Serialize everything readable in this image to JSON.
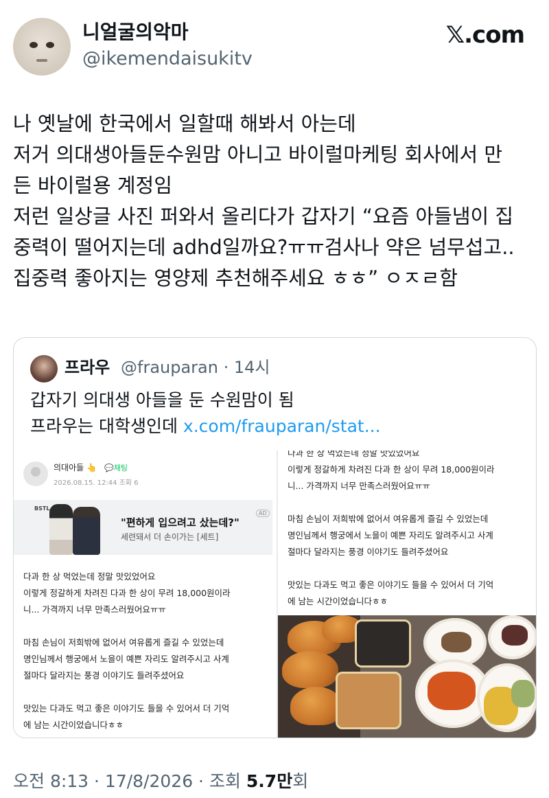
{
  "author": {
    "display_name": "니얼굴의악마",
    "handle": "@ikemendaisukitv"
  },
  "brand": "𝕏.com",
  "tweet_text": "나 옛날에 한국에서 일할때 해봐서 아는데\n저거 의대생아들둔수원맘 아니고 바이럴마케팅 회사에서 만\n든 바이럴용 계정임\n저런 일상글 사진 퍼와서 올리다가 갑자기 “요즘 아들냄이 집\n중력이 떨어지는데 adhd일까요?ㅠㅠ검사나 약은 넘무섭고..\n집중력 좋아지는 영양제 추천해주세요 ㅎㅎ” ㅇㅈㄹ함",
  "quote": {
    "display_name": "프라우",
    "handle_time": "@frauparan · 14시",
    "text_line1": "갑자기 의대생 아들을 둔 수원맘이 됨",
    "text_line2": "프라우는 대학생인데 ",
    "link": "x.com/frauparan/stat..."
  },
  "left_screenshot": {
    "author": "의대아들 👆",
    "badge": "💬채팅",
    "date": "2026.08.15. 12:44  조회 6",
    "ad_brand": "BSTL",
    "ad_title": "\"편하게 입으려고 샀는데?\"",
    "ad_subtitle": "세련돼서 더 손이가는 [세트]",
    "ad_tag": "AD",
    "body": "다과 한 상 먹었는데 정말 맛있었어요\n이렇게 정갈하게 차려진 다과 한 상이 무려 18,000원이라\n니... 가격까지 너무 만족스러웠어요ㅠㅠ\n\n마침 손님이 저희밖에 없어서 여유롭게 즐길 수 있었는데\n명인님께서 행궁에서 노을이 예쁜 자리도 알려주시고 사계\n절마다 달라지는 풍경 이야기도 들려주셨어요\n\n맛있는 다과도 먹고 좋은 이야기도 들을 수 있어서 더 기억\n에 남는 시간이었습니다ㅎㅎ"
  },
  "right_screenshot": {
    "body": "다과 한 상 먹었는데 정말 맛있었어요\n이렇게 정갈하게 차려진 다과 한 상이 무려 18,000원이라\n니... 가격까지 너무 만족스러웠어요ㅠㅠ\n\n마침 손님이 저희밖에 없어서 여유롭게 즐길 수 있었는데\n명인님께서 행궁에서 노을이 예쁜 자리도 알려주시고 사계\n절마다 달라지는 풍경 이야기도 들려주셨어요\n\n맛있는 다과도 먹고 좋은 이야기도 들을 수 있어서 더 기억\n에 남는 시간이었습니다ㅎㅎ"
  },
  "meta": {
    "time_date": "오전 8:13 · 17/8/2026 · 조회 ",
    "views": "5.7만",
    "views_suffix": "회"
  }
}
